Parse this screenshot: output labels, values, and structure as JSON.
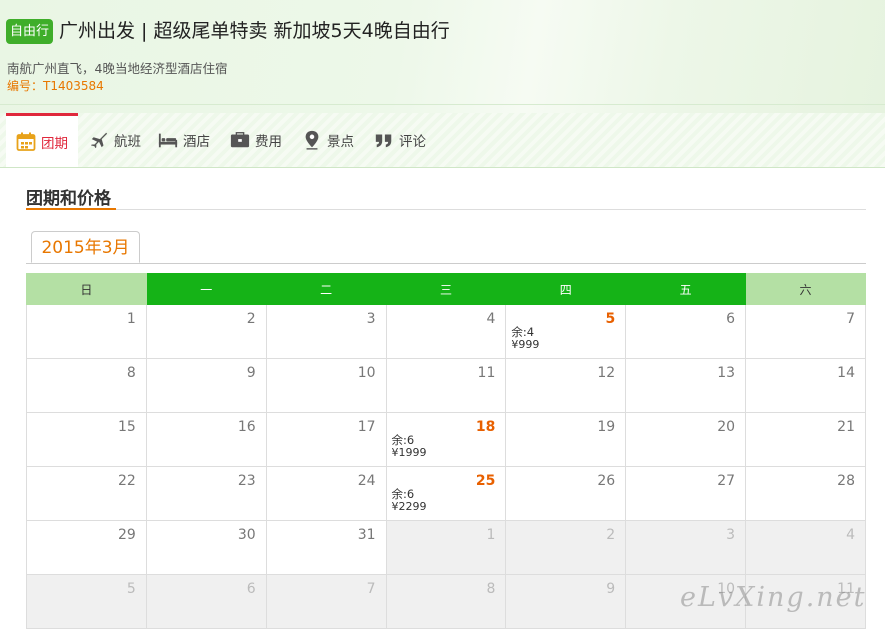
{
  "header": {
    "badge": "自由行",
    "title": "广州出发 | 超级尾单特卖 新加坡5天4晚自由行",
    "subtitle": "南航广州直飞，4晚当地经济型酒店住宿",
    "code": "编号：T1403584"
  },
  "tabs": [
    {
      "label": "团期",
      "icon": "calendar-icon",
      "active": true
    },
    {
      "label": "航班",
      "icon": "airplane-icon"
    },
    {
      "label": "酒店",
      "icon": "bed-icon"
    },
    {
      "label": "费用",
      "icon": "wallet-icon"
    },
    {
      "label": "景点",
      "icon": "location-pin-icon"
    },
    {
      "label": "评论",
      "icon": "quote-icon"
    }
  ],
  "section": {
    "title": "团期和价格"
  },
  "calendar": {
    "month": "2015年3月",
    "weekdays": [
      "日",
      "一",
      "二",
      "三",
      "四",
      "五",
      "六"
    ],
    "weeks": [
      [
        {
          "d": "1"
        },
        {
          "d": "2"
        },
        {
          "d": "3"
        },
        {
          "d": "4"
        },
        {
          "d": "5",
          "rem": "余:4",
          "price": "¥999"
        },
        {
          "d": "6"
        },
        {
          "d": "7"
        }
      ],
      [
        {
          "d": "8"
        },
        {
          "d": "9"
        },
        {
          "d": "10"
        },
        {
          "d": "11"
        },
        {
          "d": "12"
        },
        {
          "d": "13"
        },
        {
          "d": "14"
        }
      ],
      [
        {
          "d": "15"
        },
        {
          "d": "16"
        },
        {
          "d": "17"
        },
        {
          "d": "18",
          "rem": "余:6",
          "price": "¥1999"
        },
        {
          "d": "19"
        },
        {
          "d": "20"
        },
        {
          "d": "21"
        }
      ],
      [
        {
          "d": "22"
        },
        {
          "d": "23"
        },
        {
          "d": "24"
        },
        {
          "d": "25",
          "rem": "余:6",
          "price": "¥2299"
        },
        {
          "d": "26"
        },
        {
          "d": "27"
        },
        {
          "d": "28"
        }
      ],
      [
        {
          "d": "29"
        },
        {
          "d": "30"
        },
        {
          "d": "31"
        },
        {
          "d": "1",
          "other": true
        },
        {
          "d": "2",
          "other": true
        },
        {
          "d": "3",
          "other": true
        },
        {
          "d": "4",
          "other": true
        }
      ],
      [
        {
          "d": "5",
          "other": true
        },
        {
          "d": "6",
          "other": true
        },
        {
          "d": "7",
          "other": true
        },
        {
          "d": "8",
          "other": true
        },
        {
          "d": "9",
          "other": true
        },
        {
          "d": "10",
          "other": true
        },
        {
          "d": "11",
          "other": true
        }
      ]
    ]
  },
  "watermark": "eLvXing.net",
  "colors": {
    "brand_green": "#15b317",
    "accent_orange": "#e87700",
    "active_red": "#e0283c"
  }
}
